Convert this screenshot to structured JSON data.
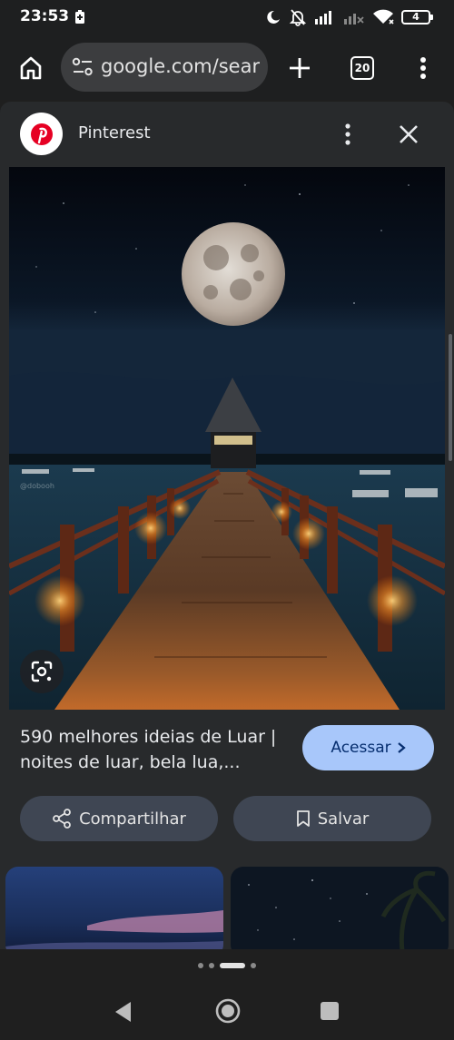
{
  "status_bar": {
    "time": "23:53",
    "battery_level": "4",
    "icons": [
      "battery-saver-icon",
      "do-not-disturb-icon",
      "mute-icon",
      "signal-icon",
      "signal-no-data-icon",
      "wifi-icon",
      "battery-icon"
    ]
  },
  "toolbar": {
    "url": "google.com/search",
    "tab_count": "20",
    "icons": [
      "home-icon",
      "site-info-icon",
      "plus-icon",
      "tabs-icon",
      "more-vert-icon"
    ]
  },
  "sheet": {
    "source_name": "Pinterest",
    "result_title": "590 melhores ideias de Luar | noites de luar, bela lua,...",
    "visit_label": "Acessar",
    "share_label": "Compartilhar",
    "save_label": "Salvar",
    "image_watermark": "@dobooh"
  },
  "colors": {
    "accent": "#a8c7fa",
    "sheet_bg": "#282a2c",
    "pinterest_red": "#e60023"
  },
  "pager": {
    "pages": 4,
    "active": 2
  }
}
